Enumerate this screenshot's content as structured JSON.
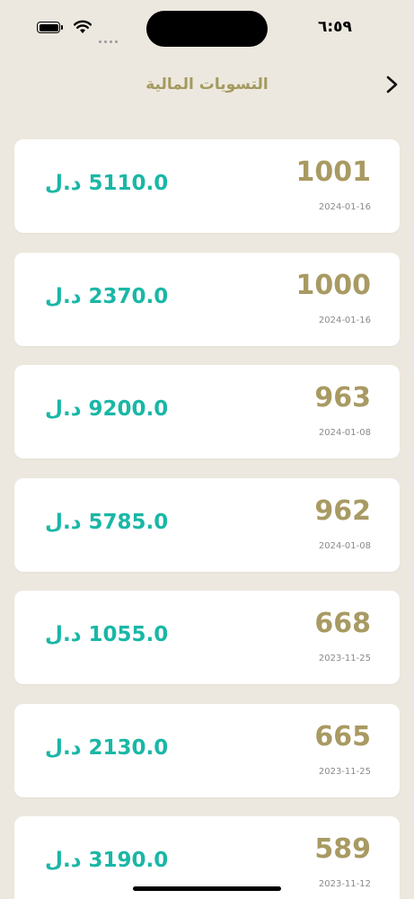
{
  "status": {
    "time": "٦:٥٩"
  },
  "header": {
    "title": "التسويات المالية"
  },
  "settlements": [
    {
      "number": "1001",
      "date": "2024-01-16",
      "amount": "5110.0 د.ل"
    },
    {
      "number": "1000",
      "date": "2024-01-16",
      "amount": "2370.0 د.ل"
    },
    {
      "number": "963",
      "date": "2024-01-08",
      "amount": "9200.0 د.ل"
    },
    {
      "number": "962",
      "date": "2024-01-08",
      "amount": "5785.0 د.ل"
    },
    {
      "number": "668",
      "date": "2023-11-25",
      "amount": "1055.0 د.ل"
    },
    {
      "number": "665",
      "date": "2023-11-25",
      "amount": "2130.0 د.ل"
    },
    {
      "number": "589",
      "date": "2023-11-12",
      "amount": "3190.0 د.ل"
    }
  ],
  "colors": {
    "background": "#ede8df",
    "title": "#a39a5e",
    "number": "#a89a62",
    "amount": "#1ab7a6"
  }
}
